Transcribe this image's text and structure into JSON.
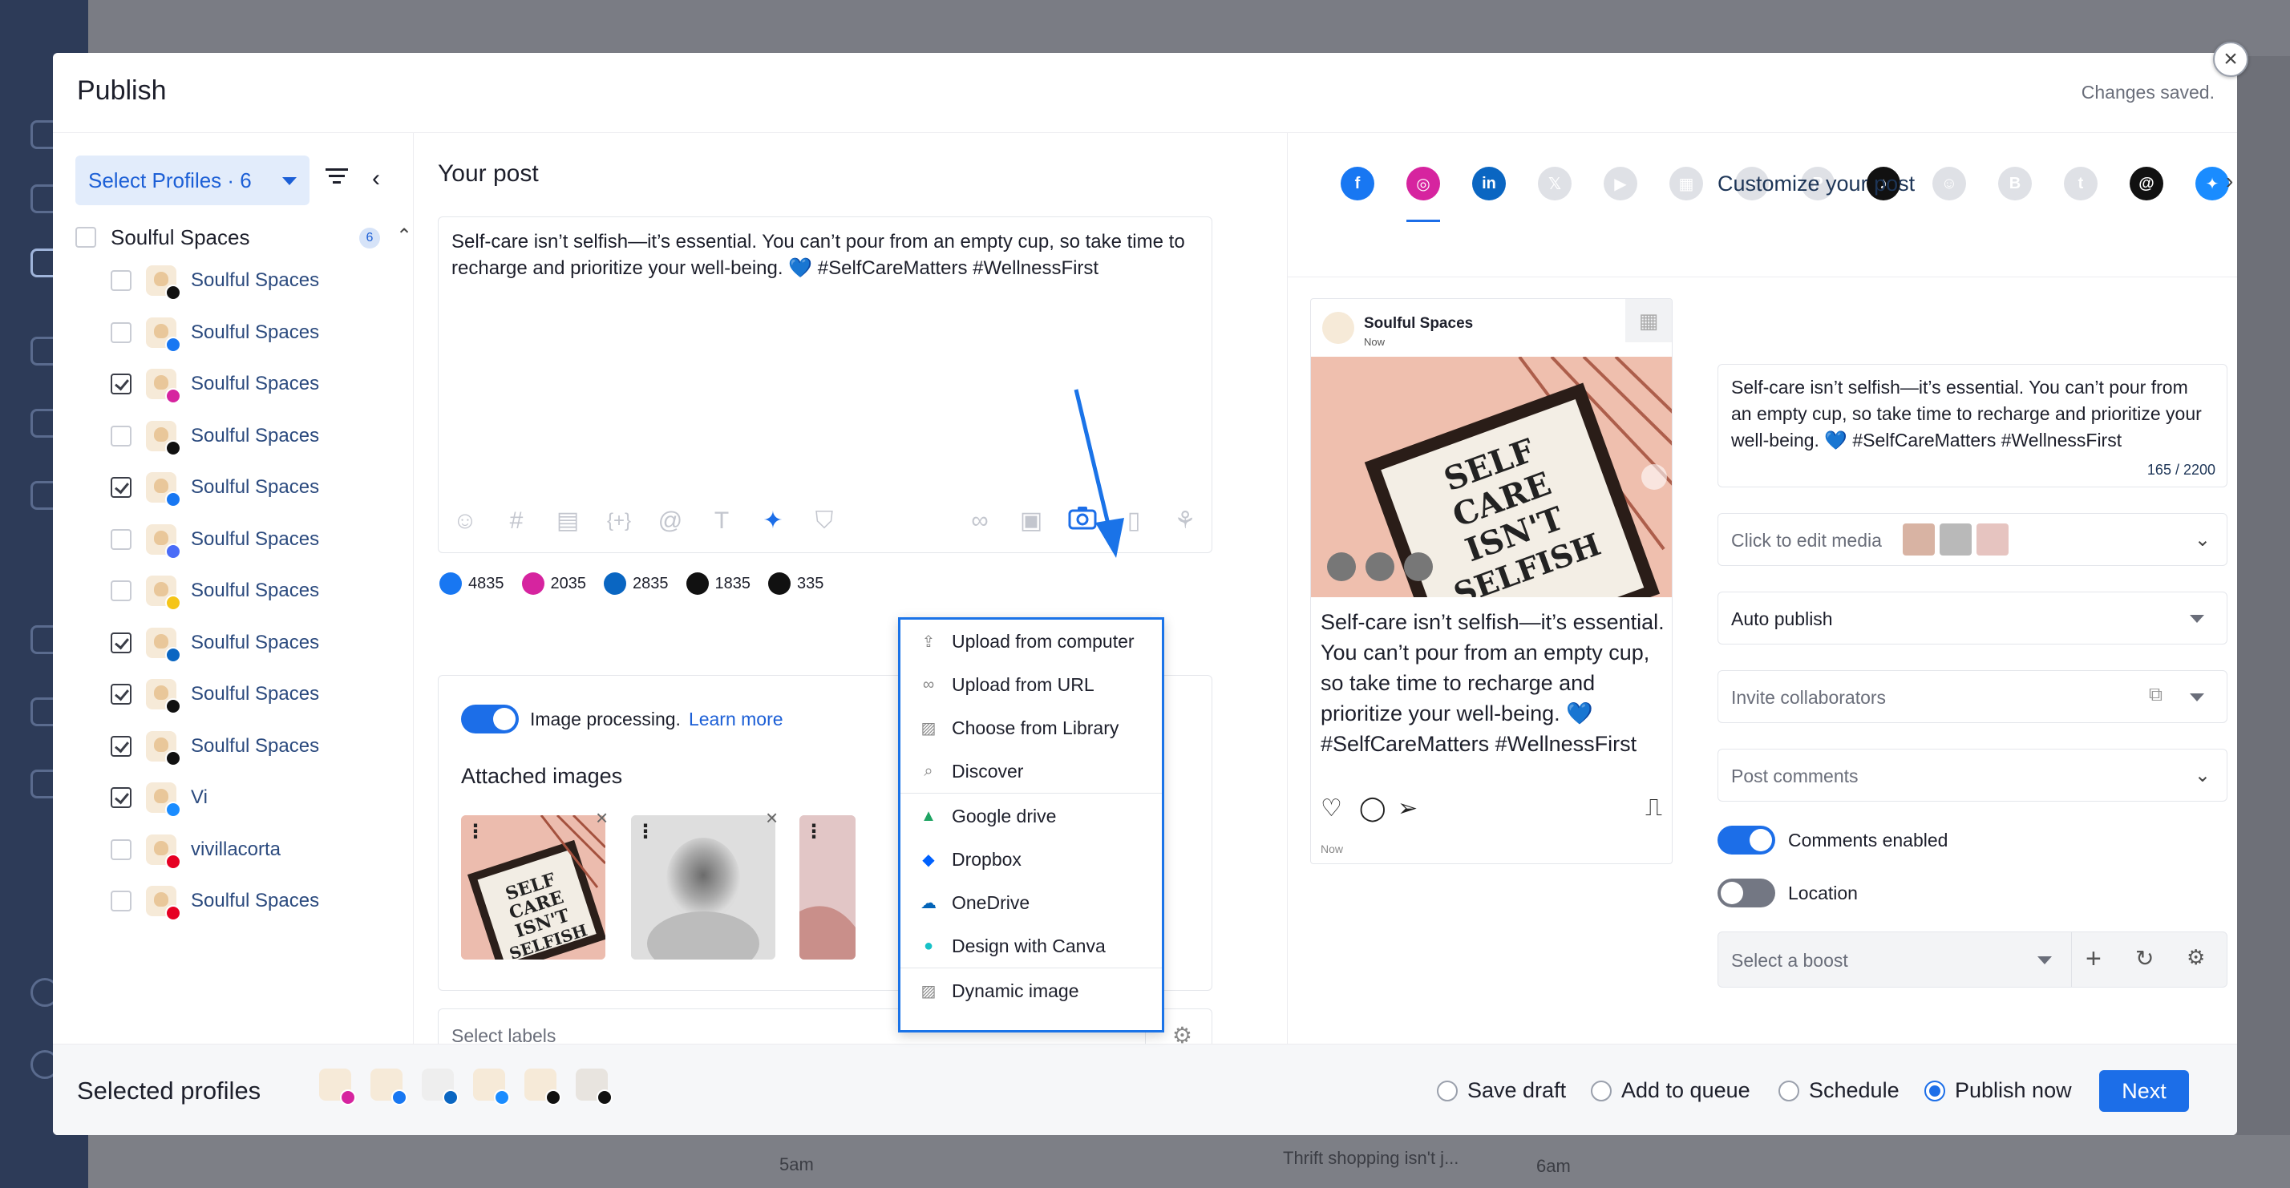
{
  "background": {
    "bottom_items": [
      "5am",
      "Thrift shopping isn't j...",
      "6am"
    ]
  },
  "modal": {
    "title": "Publish",
    "status": "Changes saved."
  },
  "left_panel": {
    "select_profiles_label": "Select Profiles · 6",
    "group": {
      "name": "Soulful Spaces",
      "count": "6"
    },
    "profiles": [
      {
        "name": "Soulful Spaces",
        "network": "tiktok",
        "checked": false
      },
      {
        "name": "Soulful Spaces",
        "network": "facebook",
        "checked": false
      },
      {
        "name": "Soulful Spaces",
        "network": "instagram",
        "checked": true
      },
      {
        "name": "Soulful Spaces",
        "network": "x",
        "checked": false
      },
      {
        "name": "Soulful Spaces",
        "network": "facebook",
        "checked": true
      },
      {
        "name": "Soulful Spaces",
        "network": "google-business",
        "checked": false
      },
      {
        "name": "Soulful Spaces",
        "network": "snapchat",
        "checked": false
      },
      {
        "name": "Soulful Spaces",
        "network": "linkedin",
        "checked": true
      },
      {
        "name": "Soulful Spaces",
        "network": "threads",
        "checked": true
      },
      {
        "name": "Soulful Spaces",
        "network": "tiktok",
        "checked": true
      },
      {
        "name": "Vi",
        "network": "bluesky",
        "checked": true
      },
      {
        "name": "vivillacorta",
        "network": "pinterest",
        "checked": false
      },
      {
        "name": "Soulful Spaces",
        "network": "pinterest",
        "checked": false
      }
    ]
  },
  "editor": {
    "title": "Your post",
    "text": "Self-care isn’t selfish—it’s essential. You can’t pour from an empty cup, so take time to recharge and prioritize your well-being. 💙 #SelfCareMatters #WellnessFirst",
    "tools": [
      "emoji-icon",
      "hashtag-icon",
      "text-snippet-icon",
      "variables-icon",
      "mention-icon",
      "text-format-icon",
      "ai-magic-icon",
      "shield-icon",
      "link-icon",
      "video-icon",
      "camera-icon",
      "document-icon",
      "media-library-icon"
    ],
    "char_counts": [
      {
        "network": "facebook",
        "value": "4835",
        "color": "#1877f2"
      },
      {
        "network": "instagram",
        "value": "2035",
        "color": "#d6249f"
      },
      {
        "network": "linkedin",
        "value": "2835",
        "color": "#0a66c2"
      },
      {
        "network": "tiktok",
        "value": "1835",
        "color": "#111111"
      },
      {
        "network": "threads",
        "value": "335",
        "color": "#111111"
      }
    ]
  },
  "media": {
    "image_processing_label": "Image processing.",
    "learn_more": "Learn more",
    "attached_title": "Attached images",
    "labels_placeholder": "Select labels"
  },
  "upload_menu": {
    "items": [
      {
        "label": "Upload from computer",
        "icon": "upload-icon"
      },
      {
        "label": "Upload from URL",
        "icon": "link-icon"
      },
      {
        "label": "Choose from Library",
        "icon": "image-icon"
      },
      {
        "label": "Discover",
        "icon": "search-icon"
      },
      {
        "label": "Google drive",
        "icon": "google-drive-icon"
      },
      {
        "label": "Dropbox",
        "icon": "dropbox-icon"
      },
      {
        "label": "OneDrive",
        "icon": "onedrive-icon"
      },
      {
        "label": "Design with Canva",
        "icon": "canva-icon"
      },
      {
        "label": "Dynamic image",
        "icon": "dynamic-image-icon"
      }
    ]
  },
  "preview": {
    "networks": [
      "facebook",
      "instagram",
      "linkedin",
      "x",
      "youtube",
      "google-business",
      "reddit",
      "pinterest",
      "tiktok",
      "snapchat",
      "blogger",
      "tumblr",
      "threads",
      "bluesky"
    ],
    "active_network": "instagram",
    "account_name": "Soulful Spaces",
    "account_sub": "Now",
    "image_text": [
      "SELF",
      "CARE",
      "ISN'T",
      "SELFISH"
    ],
    "post_text": "Self-care isn’t selfish—it’s essential. You can’t pour from an empty cup, so take time to recharge and prioritize your well-being. 💙 #SelfCareMatters #WellnessFirst",
    "timestamp": "Now"
  },
  "customize": {
    "title": "Customize your post",
    "text": "Self-care isn’t selfish—it’s essential. You can’t pour from an empty cup, so take time to recharge and prioritize your well-being. 💙 #SelfCareMatters #WellnessFirst",
    "char_count": "165 / 2200",
    "edit_media": "Click to edit media",
    "publish_mode": "Auto publish",
    "collaborators_placeholder": "Invite collaborators",
    "comments_placeholder": "Post comments",
    "comments_enabled_label": "Comments enabled",
    "location_label": "Location",
    "boost_placeholder": "Select a boost"
  },
  "footer": {
    "title": "Selected profiles",
    "options": [
      {
        "label": "Save draft",
        "selected": false
      },
      {
        "label": "Add to queue",
        "selected": false
      },
      {
        "label": "Schedule",
        "selected": false
      },
      {
        "label": "Publish now",
        "selected": true
      }
    ],
    "next_label": "Next"
  }
}
